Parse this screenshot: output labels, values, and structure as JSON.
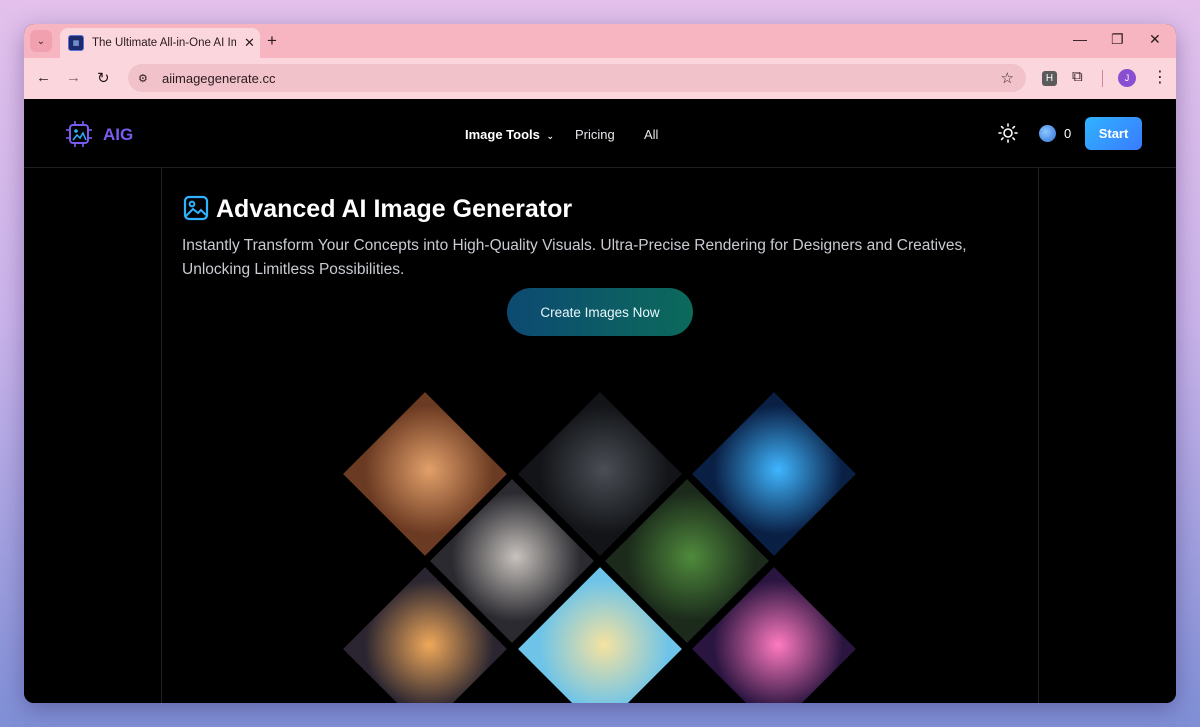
{
  "browser": {
    "tab_title": "The Ultimate All-in-One AI Imag",
    "url": "aiimagegenerate.cc",
    "extension_h_label": "H",
    "profile_initial": "J"
  },
  "header": {
    "logo_text": "AIG",
    "nav": [
      {
        "label": "Image Tools",
        "has_dropdown": true
      },
      {
        "label": "Pricing"
      },
      {
        "label": "All"
      }
    ],
    "credits": "0",
    "start_label": "Start",
    "colors": {
      "logo": "#7a5cf0",
      "start_from": "#2fb3ff",
      "start_to": "#3a7bff"
    }
  },
  "hero": {
    "title": "Advanced AI Image Generator",
    "subtitle": "Instantly Transform Your Concepts into High-Quality Visuals. Ultra-Precise Rendering for Designers and Creatives, Unlocking Limitless Possibilities.",
    "cta_label": "Create Images Now",
    "icon": "image-icon"
  },
  "gallery": {
    "images": [
      {
        "name": "freckled-woman-portrait",
        "colors": [
          "#e2a06a",
          "#6b3a22"
        ]
      },
      {
        "name": "hooded-skull-figure",
        "colors": [
          "#4a4e55",
          "#121417"
        ]
      },
      {
        "name": "electric-blue-warrior",
        "colors": [
          "#3fb6ff",
          "#0a1f44"
        ]
      },
      {
        "name": "pale-elf-portrait",
        "colors": [
          "#c8c2bd",
          "#2a2a30"
        ]
      },
      {
        "name": "forest-hand-island",
        "colors": [
          "#4f8a3c",
          "#1b2a1b"
        ]
      },
      {
        "name": "grinning-monster",
        "colors": [
          "#f0a85a",
          "#2a2530"
        ]
      },
      {
        "name": "floating-island-child",
        "colors": [
          "#f5e2a0",
          "#6ec4e8"
        ]
      },
      {
        "name": "pink-haired-cyborg",
        "colors": [
          "#ff7ac0",
          "#2a1540"
        ]
      }
    ]
  }
}
